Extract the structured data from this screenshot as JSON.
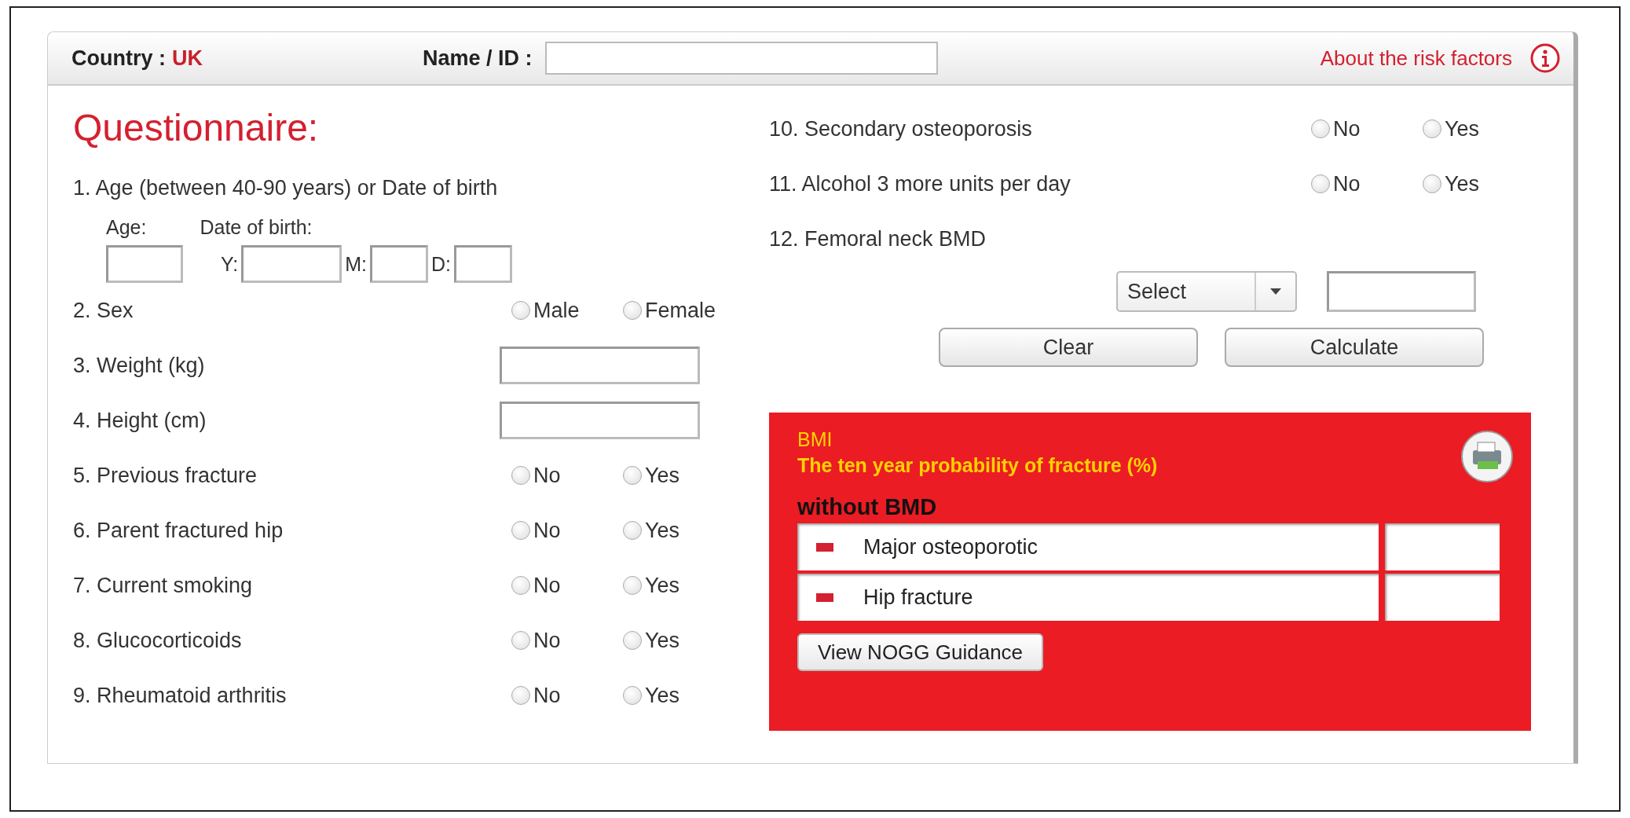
{
  "header": {
    "country_label": "Country :",
    "country_value": "UK",
    "name_label": "Name / ID :",
    "about_link": "About the risk factors"
  },
  "title": "Questionnaire:",
  "left_questions": [
    {
      "kind": "age",
      "label": "1. Age (between 40-90 years) or Date of birth",
      "age_label": "Age:",
      "dob_label": "Date of birth:",
      "dob_parts": [
        "Y:",
        "M:",
        "D:"
      ]
    },
    {
      "kind": "radio",
      "label": "2. Sex",
      "options": [
        {
          "label": "Male",
          "selected": false
        },
        {
          "label": "Female",
          "selected": false
        }
      ]
    },
    {
      "kind": "input",
      "label": "3. Weight (kg)"
    },
    {
      "kind": "input",
      "label": "4. Height (cm)"
    },
    {
      "kind": "radio",
      "label": "5. Previous fracture",
      "options": [
        {
          "label": "No",
          "selected": false
        },
        {
          "label": "Yes",
          "selected": false
        }
      ]
    },
    {
      "kind": "radio",
      "label": "6. Parent fractured hip",
      "options": [
        {
          "label": "No",
          "selected": false
        },
        {
          "label": "Yes",
          "selected": false
        }
      ]
    },
    {
      "kind": "radio",
      "label": "7. Current smoking",
      "options": [
        {
          "label": "No",
          "selected": false
        },
        {
          "label": "Yes",
          "selected": false
        }
      ]
    },
    {
      "kind": "radio",
      "label": "8. Glucocorticoids",
      "options": [
        {
          "label": "No",
          "selected": false
        },
        {
          "label": "Yes",
          "selected": false
        }
      ]
    },
    {
      "kind": "radio",
      "label": "9. Rheumatoid arthritis",
      "options": [
        {
          "label": "No",
          "selected": false
        },
        {
          "label": "Yes",
          "selected": false
        }
      ]
    }
  ],
  "right_questions": [
    {
      "kind": "radio",
      "label": "10. Secondary osteoporosis",
      "options": [
        {
          "label": "No",
          "selected": false
        },
        {
          "label": "Yes",
          "selected": false
        }
      ]
    },
    {
      "kind": "radio",
      "label": "11. Alcohol 3 more units per day",
      "options": [
        {
          "label": "No",
          "selected": false
        },
        {
          "label": "Yes",
          "selected": false
        }
      ]
    },
    {
      "kind": "label",
      "label": "12. Femoral neck BMD"
    }
  ],
  "bmd_select": "Select",
  "buttons": [
    "Clear",
    "Calculate"
  ],
  "results": {
    "bmi_label": "BMI",
    "subtitle": "The ten year probability of fracture (%)",
    "section": "without BMD",
    "rows": [
      {
        "label": "Major osteoporotic",
        "color": "#d42030"
      },
      {
        "label": "Hip fracture",
        "color": "#d42030"
      }
    ],
    "guidance_button": "View NOGG Guidance"
  }
}
